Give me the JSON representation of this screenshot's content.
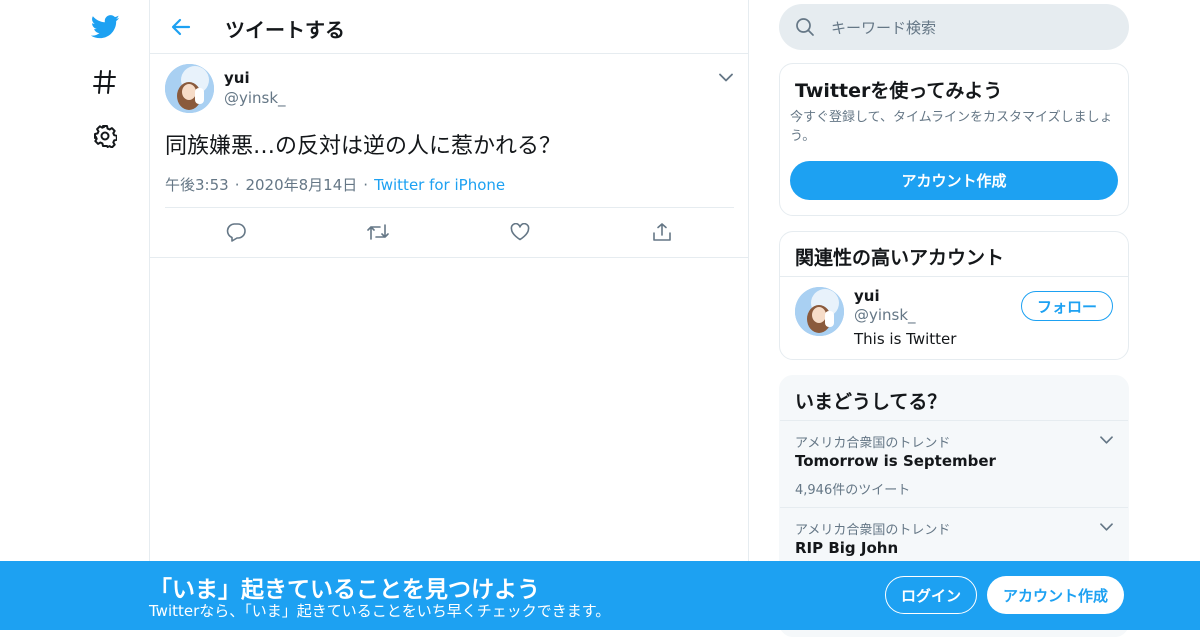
{
  "colors": {
    "accent": "#1da1f2",
    "text": "#14171a",
    "secondary": "#657786",
    "border": "#e6ecf0"
  },
  "nav": {
    "items": [
      {
        "icon": "twitter-bird-icon"
      },
      {
        "icon": "hashtag-icon"
      },
      {
        "icon": "settings-gear-icon"
      }
    ]
  },
  "header": {
    "title": "ツイートする",
    "back_icon": "arrow-left-icon"
  },
  "tweet": {
    "author_name": "yui",
    "author_handle": "@yinsk_",
    "text": "同族嫌悪…の反対は逆の人に惹かれる？",
    "time": "午後3:53",
    "date": "2020年8月14日",
    "separator": "·",
    "source": "Twitter for iPhone",
    "actions": [
      "reply-icon",
      "retweet-icon",
      "like-icon",
      "share-icon"
    ]
  },
  "search": {
    "placeholder": "キーワード検索"
  },
  "signup_card": {
    "title": "Twitterを使ってみよう",
    "description": "今すぐ登録して、タイムラインをカスタマイズしましょう。",
    "button": "アカウント作成"
  },
  "related": {
    "title": "関連性の高いアカウント",
    "account": {
      "name": "yui",
      "handle": "@yinsk_",
      "bio": "This is Twitter",
      "follow_label": "フォロー"
    }
  },
  "trends": {
    "title": "いまどうしてる？",
    "items": [
      {
        "context": "アメリカ合衆国のトレンド",
        "name": "Tomorrow is September",
        "count": "4,946件のツイート"
      },
      {
        "context": "アメリカ合衆国のトレンド",
        "name": "RIP Big John",
        "count": ""
      }
    ]
  },
  "bottom_bar": {
    "title": "「いま」起きていることを見つけよう",
    "subtitle": "Twitterなら、「いま」起きていることをいち早くチェックできます。",
    "login": "ログイン",
    "signup": "アカウント作成"
  }
}
